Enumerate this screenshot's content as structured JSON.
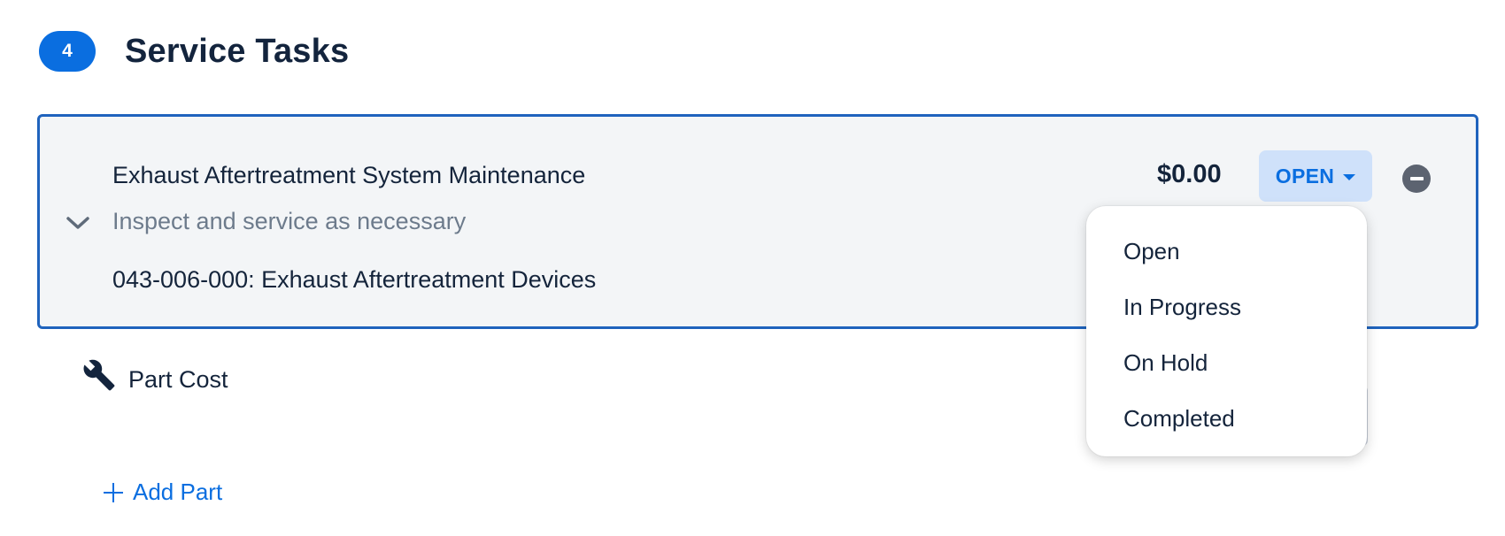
{
  "section": {
    "count": "4",
    "title": "Service Tasks"
  },
  "task": {
    "title": "Exhaust Aftertreatment System Maintenance",
    "description": "Inspect and service as necessary",
    "code": "043-006-000: Exhaust Aftertreatment Devices",
    "cost": "$0.00",
    "status": "OPEN",
    "icons": {
      "expand": "chevron-down-icon",
      "remove": "minus-circle-icon",
      "status_caret": "caret-down-icon"
    }
  },
  "part_cost": {
    "label": "Part Cost",
    "icon": "wrench-icon"
  },
  "add_part": {
    "label": "Add Part",
    "icon": "plus-icon"
  },
  "status_dropdown": {
    "options": [
      "Open",
      "In Progress",
      "On Hold",
      "Completed"
    ]
  },
  "colors": {
    "accent": "#0a6ee0",
    "card_border": "#1f63bd",
    "card_bg": "#f3f5f7",
    "status_bg": "#cfe1fa",
    "text_primary": "#14243b",
    "text_secondary": "#6d7b8c"
  }
}
